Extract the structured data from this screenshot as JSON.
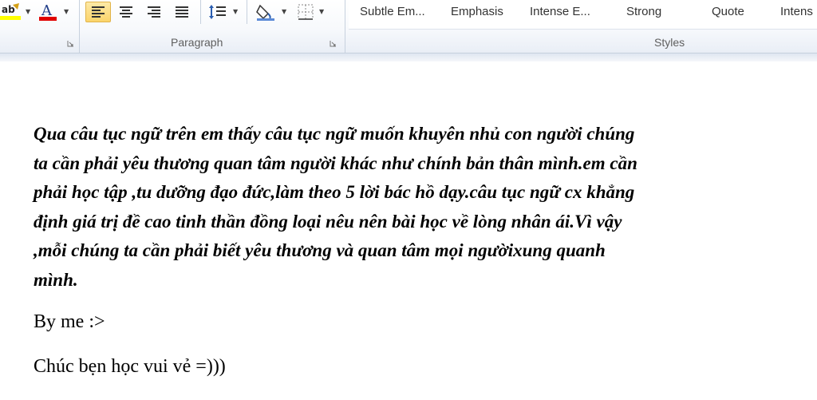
{
  "ribbon": {
    "paragraph_group_label": "Paragraph",
    "styles_group_label": "Styles",
    "colors": {
      "highlight": "#ffff00",
      "font_color": "#e00000",
      "active_tool": "#fbd46b"
    },
    "styles": [
      "Subtle Em...",
      "Emphasis",
      "Intense E...",
      "Strong",
      "Quote",
      "Intens"
    ]
  },
  "document": {
    "paragraph_lines": [
      "Qua câu tục ngữ trên em thấy câu tục ngữ muốn khuyên nhủ con người chúng",
      "ta cần phải yêu thương quan tâm người khác như chính bản thân mình.em cần",
      "phải học tập ,tu dưỡng  đạo đức,làm theo 5 lời bác hồ dạy.câu tục ngữ cx khẳng",
      "định  giá trị đề cao tinh thần đồng loại nêu nên bài học về lòng nhân ái.Vì vậy",
      ",mỗi chúng ta cần phải biết yêu thương và quan tâm  mọi ngườixung quanh",
      "mình."
    ],
    "line2": "By me :>",
    "line3": "Chúc bẹn học vui vẻ =)))"
  }
}
